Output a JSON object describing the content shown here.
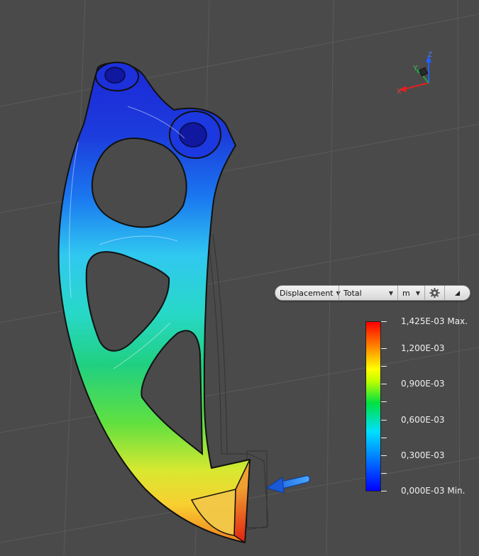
{
  "toolbar": {
    "result_type": "Displacement",
    "component": "Total",
    "unit": "m",
    "settings_icon": "gear-icon",
    "collapse_icon": "triangle-collapse-icon"
  },
  "triad": {
    "z_label": "Z",
    "y_label": "Y",
    "x_label": "X"
  },
  "legend": {
    "max_label": "1,425E-03 Max.",
    "labels": [
      "1,200E-03",
      "0,900E-03",
      "0,600E-03",
      "0,300E-03"
    ],
    "min_label": "0,000E-03 Min.",
    "colors": [
      "#0000ff",
      "#00e0ff",
      "#00e040",
      "#ffff00",
      "#ff0000"
    ]
  },
  "colors": {
    "background": "#4a4a4a",
    "grid": "#5c5c5c",
    "load_arrow": "#2a7bff"
  }
}
